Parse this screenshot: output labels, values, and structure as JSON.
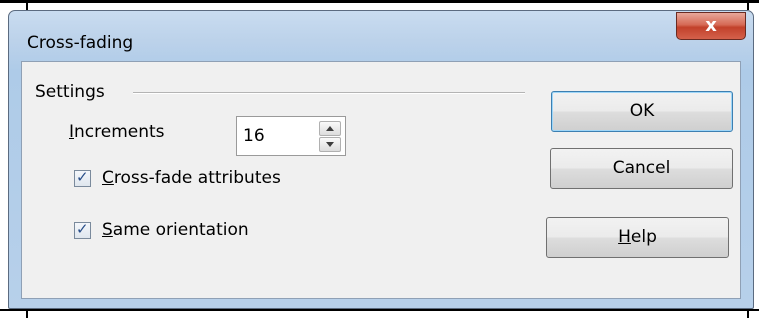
{
  "dialog": {
    "title": "Cross-fading",
    "close_glyph": "x"
  },
  "settings": {
    "group_label": "Settings",
    "increments": {
      "label_access": "I",
      "label_rest": "ncrements",
      "value": "16"
    },
    "crossfade_attributes": {
      "label_access": "C",
      "label_rest": "ross-fade attributes",
      "checked": true
    },
    "same_orientation": {
      "label_access": "S",
      "label_rest": "ame orientation",
      "checked": true
    },
    "check_glyph": "✓"
  },
  "buttons": {
    "ok": "OK",
    "cancel": "Cancel",
    "help_access": "H",
    "help_rest": "elp"
  }
}
